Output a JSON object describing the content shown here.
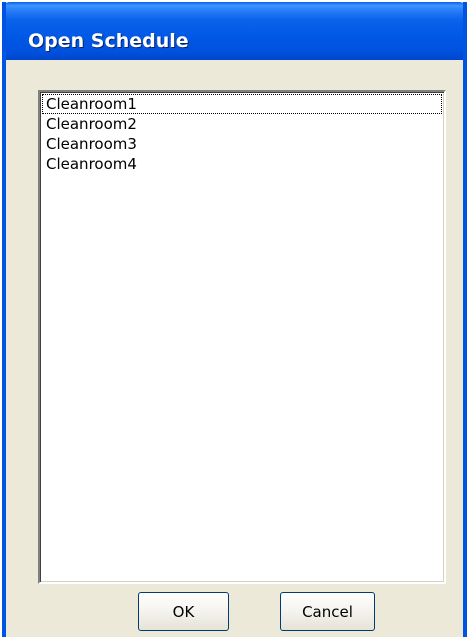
{
  "dialog": {
    "title": "Open Schedule"
  },
  "list": {
    "items": [
      "Cleanroom1",
      "Cleanroom2",
      "Cleanroom3",
      "Cleanroom4"
    ],
    "focused_index": 0
  },
  "buttons": {
    "ok_label": "OK",
    "cancel_label": "Cancel"
  },
  "colors": {
    "titlebar": "#0058e6",
    "dialog_background": "#ece9d8",
    "list_background": "#ffffff"
  }
}
